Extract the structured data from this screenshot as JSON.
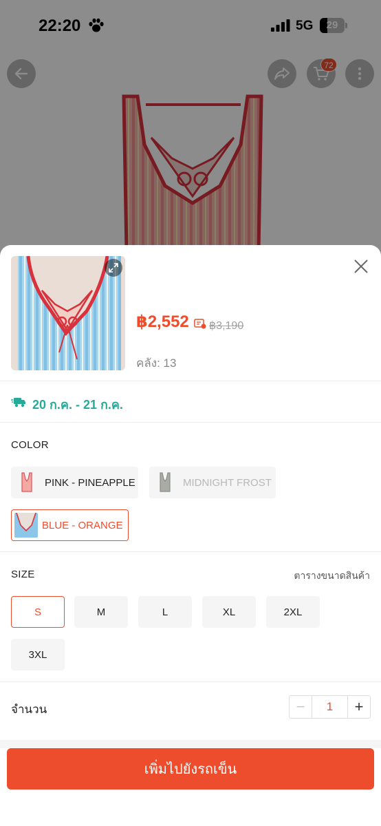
{
  "status_bar": {
    "time": "22:20",
    "network": "5G",
    "battery": "29"
  },
  "background_page": {
    "cart_count": "72",
    "icons": [
      "back-arrow-icon",
      "share-icon",
      "cart-icon",
      "more-icon"
    ]
  },
  "sheet": {
    "price": "฿2,552",
    "original_price": "฿3,190",
    "stock": "คลัง: 13",
    "delivery": "20 ก.ค. - 21 ก.ค.",
    "color_section": {
      "label": "COLOR",
      "options": [
        {
          "label": "PINK - PINEAPPLE",
          "state": "available"
        },
        {
          "label": "MIDNIGHT FROST",
          "state": "disabled"
        },
        {
          "label": "BLUE - ORANGE",
          "state": "selected"
        }
      ]
    },
    "size_section": {
      "label": "SIZE",
      "guide": "ตารางขนาดสินค้า",
      "options": [
        {
          "label": "S",
          "state": "selected"
        },
        {
          "label": "M",
          "state": "available"
        },
        {
          "label": "L",
          "state": "available"
        },
        {
          "label": "XL",
          "state": "available"
        },
        {
          "label": "2XL",
          "state": "available"
        },
        {
          "label": "3XL",
          "state": "available"
        }
      ]
    },
    "quantity": {
      "label": "จำนวน",
      "minus": "−",
      "value": "1",
      "plus": "+"
    },
    "add_to_cart": "เพิ่มไปยังรถเข็น"
  },
  "colors": {
    "accent": "#ee4d2d",
    "delivery": "#26aa99"
  }
}
